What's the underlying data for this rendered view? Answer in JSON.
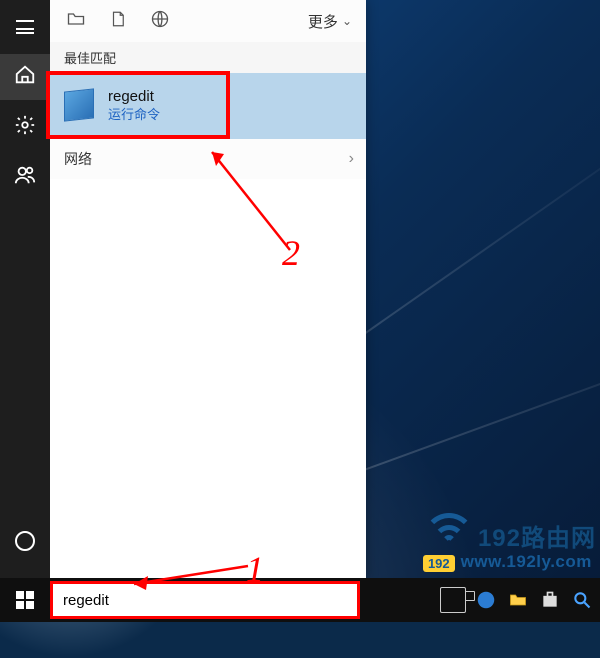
{
  "header": {
    "more_label": "更多"
  },
  "sections": {
    "best_match": "最佳匹配",
    "network": "网络"
  },
  "result": {
    "title": "regedit",
    "subtitle": "运行命令"
  },
  "search": {
    "value": "regedit"
  },
  "annotations": {
    "step1": "1",
    "step2": "2"
  },
  "watermark": {
    "badge": "192",
    "brand": "192路由网",
    "url": "www.192ly.com"
  },
  "icons": {
    "hamburger": "hamburger-icon",
    "home": "home-icon",
    "settings": "gear-icon",
    "people": "people-icon",
    "cortana": "cortana-ring-icon",
    "folder": "folder-icon",
    "document": "document-icon",
    "globe": "globe-icon"
  }
}
